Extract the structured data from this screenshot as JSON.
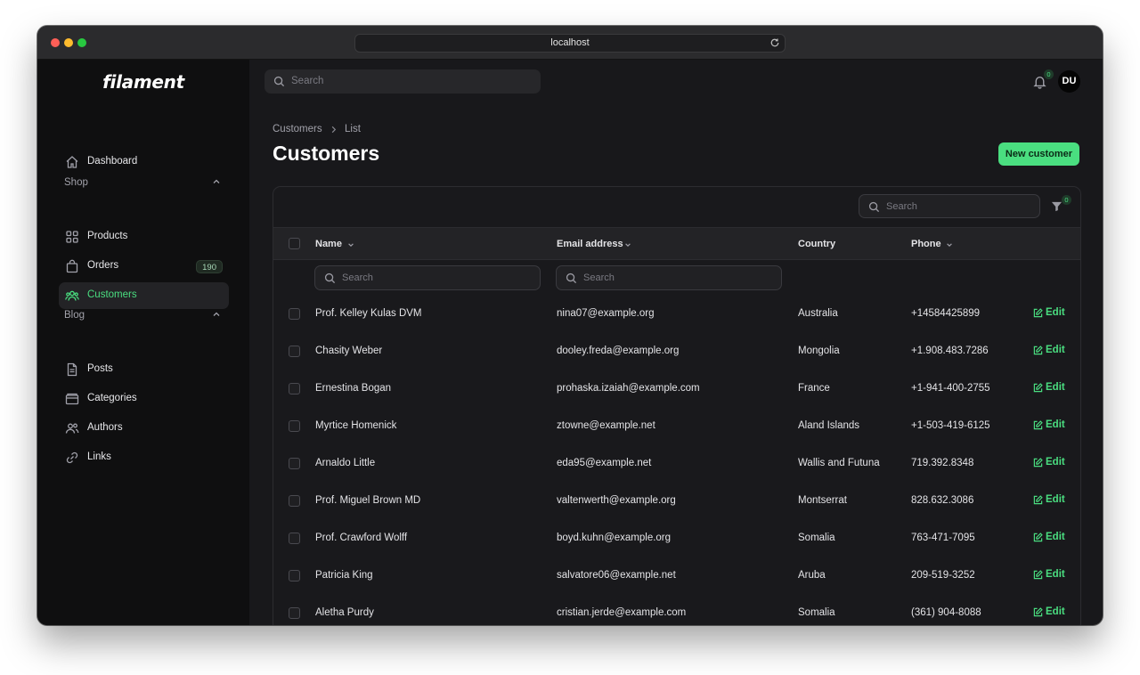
{
  "browser": {
    "url": "localhost"
  },
  "brand": "filament",
  "sidebar": {
    "dashboard": "Dashboard",
    "groups": [
      {
        "label": "Shop",
        "items": [
          {
            "label": "Products",
            "icon": "grid-icon"
          },
          {
            "label": "Orders",
            "icon": "bag-icon",
            "badge": "190"
          },
          {
            "label": "Customers",
            "icon": "users-icon",
            "active": true
          }
        ]
      },
      {
        "label": "Blog",
        "items": [
          {
            "label": "Posts",
            "icon": "document-icon"
          },
          {
            "label": "Categories",
            "icon": "folder-icon"
          },
          {
            "label": "Authors",
            "icon": "users-icon"
          },
          {
            "label": "Links",
            "icon": "link-icon"
          }
        ]
      }
    ]
  },
  "topbar": {
    "search_placeholder": "Search",
    "notifications_count": "0",
    "avatar_initials": "DU"
  },
  "breadcrumb": {
    "parent": "Customers",
    "current": "List"
  },
  "page": {
    "title": "Customers",
    "new_button": "New customer"
  },
  "table": {
    "search_placeholder": "Search",
    "filter_count": "0",
    "columns": {
      "name": "Name",
      "email": "Email address",
      "country": "Country",
      "phone": "Phone"
    },
    "column_search_placeholder": "Search",
    "edit_label": "Edit",
    "rows": [
      {
        "name": "Prof. Kelley Kulas DVM",
        "email": "nina07@example.org",
        "country": "Australia",
        "phone": "+14584425899"
      },
      {
        "name": "Chasity Weber",
        "email": "dooley.freda@example.org",
        "country": "Mongolia",
        "phone": "+1.908.483.7286"
      },
      {
        "name": "Ernestina Bogan",
        "email": "prohaska.izaiah@example.com",
        "country": "France",
        "phone": "+1-941-400-2755"
      },
      {
        "name": "Myrtice Homenick",
        "email": "ztowne@example.net",
        "country": "Aland Islands",
        "phone": "+1-503-419-6125"
      },
      {
        "name": "Arnaldo Little",
        "email": "eda95@example.net",
        "country": "Wallis and Futuna",
        "phone": "719.392.8348"
      },
      {
        "name": "Prof. Miguel Brown MD",
        "email": "valtenwerth@example.org",
        "country": "Montserrat",
        "phone": "828.632.3086"
      },
      {
        "name": "Prof. Crawford Wolff",
        "email": "boyd.kuhn@example.org",
        "country": "Somalia",
        "phone": "763-471-7095"
      },
      {
        "name": "Patricia King",
        "email": "salvatore06@example.net",
        "country": "Aruba",
        "phone": "209-519-3252"
      },
      {
        "name": "Aletha Purdy",
        "email": "cristian.jerde@example.com",
        "country": "Somalia",
        "phone": "(361) 904-8088"
      }
    ]
  },
  "colors": {
    "accent": "#4ade80",
    "background": "#18181b",
    "sidebar": "#0f0f10"
  }
}
